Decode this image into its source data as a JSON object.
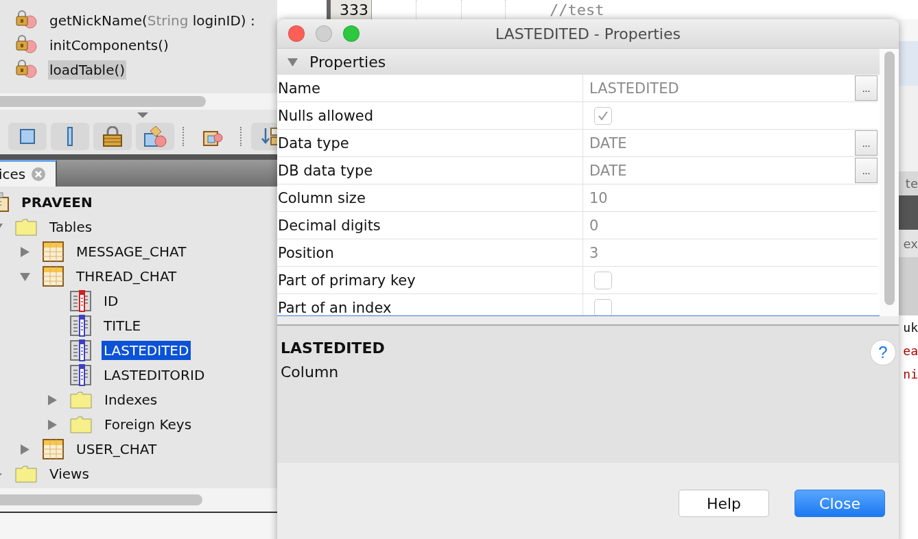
{
  "members": [
    {
      "name": "getNickName(",
      "param_type": "String",
      "rest": " loginID) :",
      "selected": false
    },
    {
      "name": "initComponents()",
      "selected": false
    },
    {
      "name": "loadTable()",
      "selected": true
    }
  ],
  "panel_tab": {
    "label": "ices"
  },
  "tree": [
    {
      "label": "PRAVEEN",
      "kind": "database",
      "selected": false,
      "children": [
        {
          "label": "Tables",
          "kind": "folder",
          "expanded": true,
          "selected": false,
          "children": [
            {
              "label": "MESSAGE_CHAT",
              "kind": "table",
              "expanded": false,
              "selected": false
            },
            {
              "label": "THREAD_CHAT",
              "kind": "table",
              "expanded": true,
              "selected": false,
              "children": [
                {
                  "label": "ID",
                  "kind": "key_column",
                  "selected": false
                },
                {
                  "label": "TITLE",
                  "kind": "column",
                  "selected": false
                },
                {
                  "label": "LASTEDITED",
                  "kind": "column",
                  "selected": true
                },
                {
                  "label": "LASTEDITORID",
                  "kind": "column",
                  "selected": false
                },
                {
                  "label": "Indexes",
                  "kind": "folder",
                  "expanded": false,
                  "selected": false
                },
                {
                  "label": "Foreign Keys",
                  "kind": "folder",
                  "expanded": false,
                  "selected": false
                }
              ]
            },
            {
              "label": "USER_CHAT",
              "kind": "table",
              "expanded": false,
              "selected": false
            }
          ]
        },
        {
          "label": "Views",
          "kind": "folder",
          "expanded": false,
          "selected": false
        }
      ]
    }
  ],
  "editor": {
    "line_number": "333",
    "code": "//test",
    "edge_tabs": [
      {
        "text": "te"
      },
      {
        "text": "ex"
      }
    ],
    "edge_code": [
      {
        "text": "uk",
        "kind": "plain"
      },
      {
        "text": "ea",
        "kind": "error"
      },
      {
        "text": "ni",
        "kind": "error"
      }
    ]
  },
  "dialog": {
    "title": "LASTEDITED - Properties",
    "section": {
      "label": "Properties",
      "expanded": true
    },
    "properties": [
      {
        "label": "Name",
        "kind": "text",
        "value": "LASTEDITED",
        "editor_button": "..."
      },
      {
        "label": "Nulls allowed",
        "kind": "checkbox",
        "checked": true
      },
      {
        "label": "Data type",
        "kind": "text",
        "value": "DATE",
        "editor_button": "..."
      },
      {
        "label": "DB data type",
        "kind": "text",
        "value": "DATE",
        "editor_button": "..."
      },
      {
        "label": "Column size",
        "kind": "text",
        "value": "10"
      },
      {
        "label": "Decimal digits",
        "kind": "text",
        "value": "0"
      },
      {
        "label": "Position",
        "kind": "text",
        "value": "3"
      },
      {
        "label": "Part of primary key",
        "kind": "checkbox",
        "checked": false
      },
      {
        "label": "Part of an index",
        "kind": "checkbox",
        "checked": false
      }
    ],
    "description": {
      "title": "LASTEDITED",
      "text": "Column",
      "help": "?"
    },
    "buttons": [
      {
        "label": "Help",
        "default": false
      },
      {
        "label": "Close",
        "default": true
      }
    ]
  }
}
